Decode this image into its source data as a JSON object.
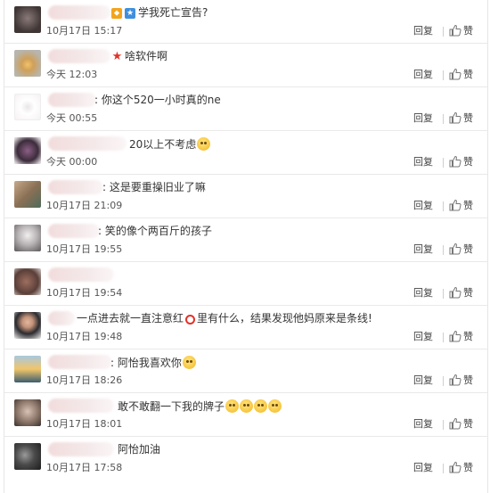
{
  "actions": {
    "reply": "回复",
    "like": "赞"
  },
  "comments": [
    {
      "text": "学我死亡宣告?",
      "time": "10月17日 15:17"
    },
    {
      "text": "啥软件啊",
      "time": "今天 12:03"
    },
    {
      "text": ": 你这个520一小时真的ne",
      "time": "今天 00:55"
    },
    {
      "text": "20以上不考虑",
      "time": "今天 00:00"
    },
    {
      "text": ": 这是要重操旧业了嘛",
      "time": "10月17日 21:09"
    },
    {
      "text": ": 笑的像个两百斤的孩子",
      "time": "10月17日 19:55"
    },
    {
      "text": "",
      "time": "10月17日 19:54"
    },
    {
      "text_a": "一点进去就一直注意红",
      "text_b": "里有什么，结果发现他妈原来是条线!",
      "time": "10月17日 19:48"
    },
    {
      "text": ": 阿怡我喜欢你",
      "time": "10月17日 18:26"
    },
    {
      "text": "敢不敢翻一下我的牌子",
      "time": "10月17日 18:01"
    },
    {
      "text": "阿怡加油",
      "time": "10月17日 17:58"
    }
  ],
  "colors": {
    "accent_red": "#e2322a",
    "divider": "#e9e9e9"
  }
}
